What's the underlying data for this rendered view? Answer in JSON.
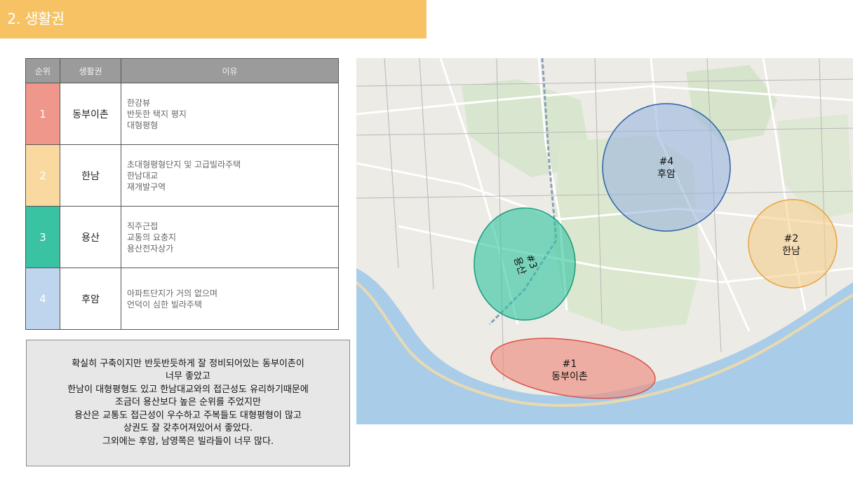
{
  "title": "2. 생활권",
  "table": {
    "headers": [
      "순위",
      "생활권",
      "이유"
    ],
    "rows": [
      {
        "rank": "1",
        "area": "동부이촌",
        "reasons": [
          "한강뷰",
          "반듯한 택지 평지",
          "대형평형"
        ],
        "color": "#ef978a"
      },
      {
        "rank": "2",
        "area": "한남",
        "reasons": [
          "초대형평형단지 및 고급빌라주택",
          "한남대교",
          "재개발구역"
        ],
        "color": "#f9d9a0"
      },
      {
        "rank": "3",
        "area": "용산",
        "reasons": [
          "직주근접",
          "교통의 요충지",
          "용산전자상가"
        ],
        "color": "#3ac3a2"
      },
      {
        "rank": "4",
        "area": "후암",
        "reasons": [
          "아파트단지가 거의 없으며",
          "언덕이 심한 빌라주택"
        ],
        "color": "#bfd5ee"
      }
    ]
  },
  "note_lines": [
    "확실히 구축이지만 반듯반듯하게 잘 정비되어있는 동부이촌이",
    "너무 좋았고",
    "한남이 대형평형도 있고 한남대교와의 접근성도 유리하기때문에",
    "조금더 용산보다 높은 순위를 주었지만",
    "용산은 교통도 접근성이 우수하고 주복들도 대형평형이 많고",
    "상권도 잘 갖추어져있어서 좋았다.",
    "그외에는 후암, 남영쪽은 빌라들이 너무 많다."
  ],
  "map": {
    "zones": [
      {
        "id": "zone-1",
        "num": "#1",
        "name": "동부이촌",
        "fill": "#f08c7e",
        "stroke": "#d9534a"
      },
      {
        "id": "zone-2",
        "num": "#2",
        "name": "한남",
        "fill": "#f7cf8c",
        "stroke": "#e8a33c"
      },
      {
        "id": "zone-3",
        "num": "#3",
        "name": "용산",
        "fill": "#2ec4a0",
        "stroke": "#1a9a78"
      },
      {
        "id": "zone-4",
        "num": "#4",
        "name": "후암",
        "fill": "#9bb6e0",
        "stroke": "#2d5fa6"
      }
    ]
  }
}
